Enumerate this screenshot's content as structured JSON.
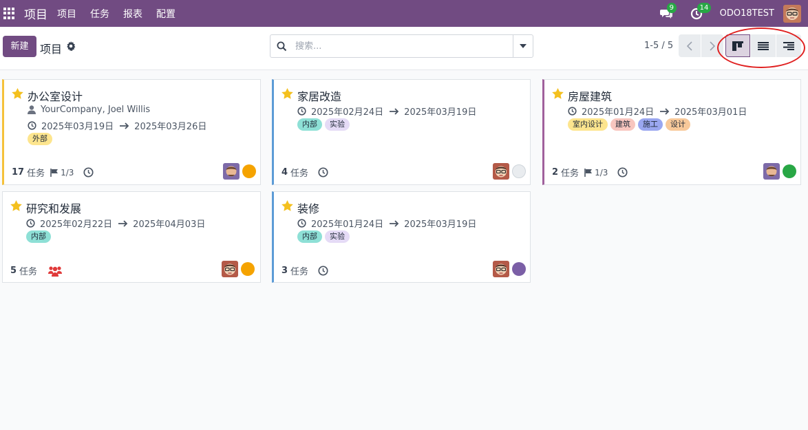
{
  "navbar": {
    "app_title": "项目",
    "menu": [
      "项目",
      "任务",
      "报表",
      "配置"
    ],
    "messages_count": "9",
    "activities_count": "14",
    "database": "ODO18TEST",
    "color": "#714b82"
  },
  "control": {
    "new_label": "新建",
    "title": "项目",
    "search_placeholder": "搜索...",
    "pager": "1-5 / 5",
    "views": [
      "kanban-icon",
      "list-icon",
      "activity-icon"
    ]
  },
  "cards": [
    {
      "title": "办公室设计",
      "customer": "YourCompany, Joel Willis",
      "date_start": "2025年03月19日",
      "date_end": "2025年03月26日",
      "tags": [
        {
          "label": "外部",
          "color": "#fde58e"
        }
      ],
      "task_count": "17",
      "task_label": "任务",
      "milestone": "1/3",
      "status_color": "#f5a300",
      "accent": "#f5c13a",
      "avatar": "person-brown"
    },
    {
      "title": "家居改造",
      "date_start": "2025年02月24日",
      "date_end": "2025年03月19日",
      "tags": [
        {
          "label": "内部",
          "color": "#8ee0d6"
        },
        {
          "label": "实验",
          "color": "#e5dbf6"
        }
      ],
      "task_count": "4",
      "task_label": "任务",
      "status_color": "#e9ecef",
      "accent": "#5c9bd6",
      "avatar": "person-glasses"
    },
    {
      "title": "房屋建筑",
      "date_start": "2025年01月24日",
      "date_end": "2025年03月01日",
      "tags": [
        {
          "label": "室内设计",
          "color": "#fde58e"
        },
        {
          "label": "建筑",
          "color": "#f8c6bf"
        },
        {
          "label": "施工",
          "color": "#9aa7f0"
        },
        {
          "label": "设计",
          "color": "#f8c99a"
        }
      ],
      "task_count": "2",
      "task_label": "任务",
      "milestone": "1/3",
      "status_color": "#28a745",
      "accent": "#a0609c",
      "avatar": "person-brown"
    },
    {
      "title": "研究和发展",
      "date_start": "2025年02月22日",
      "date_end": "2025年04月03日",
      "tags": [
        {
          "label": "内部",
          "color": "#8ee0d6"
        }
      ],
      "task_count": "5",
      "task_label": "任务",
      "status_color": "#f5a300",
      "accent": "#dee2e6",
      "avatar": "person-glasses"
    },
    {
      "title": "装修",
      "date_start": "2025年01月24日",
      "date_end": "2025年03月19日",
      "tags": [
        {
          "label": "内部",
          "color": "#8ee0d6"
        },
        {
          "label": "实验",
          "color": "#e5dbf6"
        }
      ],
      "task_count": "3",
      "task_label": "任务",
      "status_color": "#7b5fa6",
      "accent": "#5c9bd6",
      "avatar": "person-glasses"
    }
  ]
}
